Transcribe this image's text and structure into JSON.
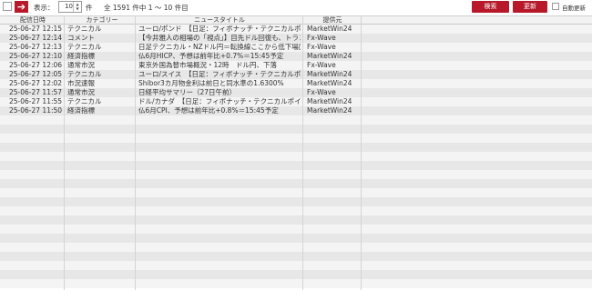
{
  "toolbar": {
    "arrow_glyph": "➔",
    "display_label": "表示：",
    "count_value": "10",
    "count_unit": "件",
    "summary": "全 1591 件中 1 ～ 10 件目",
    "search_label": "検索",
    "refresh_label": "更新",
    "auto_refresh_label": "自動更新"
  },
  "table": {
    "columns": [
      "配信日時",
      "カテゴリー",
      "ニュースタイトル",
      "提供元"
    ],
    "rows": [
      [
        "25-06-27 12:15",
        "テクニカル",
        "ユーロ/ポンド　【日足：フィボナッチ・テクニカルポイ",
        "MarketWin24"
      ],
      [
        "25-06-27 12:14",
        "コメント",
        "【今井雅人の相場の「視点」】目先ドル回復も、トラン",
        "Fx-Wave"
      ],
      [
        "25-06-27 12:13",
        "テクニカル",
        "日足テクニカル・NZドル円＝転換線ここから低下場面も",
        "Fx-Wave"
      ],
      [
        "25-06-27 12:10",
        "経済指標",
        "仏6月HICP、予想は前年比+0.7%＝15:45予定",
        "MarketWin24"
      ],
      [
        "25-06-27 12:06",
        "通常市況",
        "東京外国為替市場概況・12時　ドル円、下落",
        "Fx-Wave"
      ],
      [
        "25-06-27 12:05",
        "テクニカル",
        "ユーロ/スイス　【日足：フィボナッチ・テクニカルポイ",
        "MarketWin24"
      ],
      [
        "25-06-27 12:02",
        "市況速報",
        "Shibor3カ月物金利は前日と同水準の1.6300%",
        "MarketWin24"
      ],
      [
        "25-06-27 11:57",
        "通常市況",
        "日経平均サマリー（27日午前）",
        "Fx-Wave"
      ],
      [
        "25-06-27 11:55",
        "テクニカル",
        "ドル/カナダ　【日足：フィボナッチ・テクニカルポイン",
        "MarketWin24"
      ],
      [
        "25-06-27 11:50",
        "経済指標",
        "仏6月CPI、予想は前年比+0.8%＝15:45予定",
        "MarketWin24"
      ]
    ]
  },
  "colors": {
    "accent": "#b7192a",
    "row_light": "#f4f4f4",
    "row_dark": "#e7e7e7",
    "header_bg": "#f2f2f2"
  },
  "icons": {
    "arrow": "right-arrow-icon",
    "spinner": "spinner-arrows-icon"
  }
}
